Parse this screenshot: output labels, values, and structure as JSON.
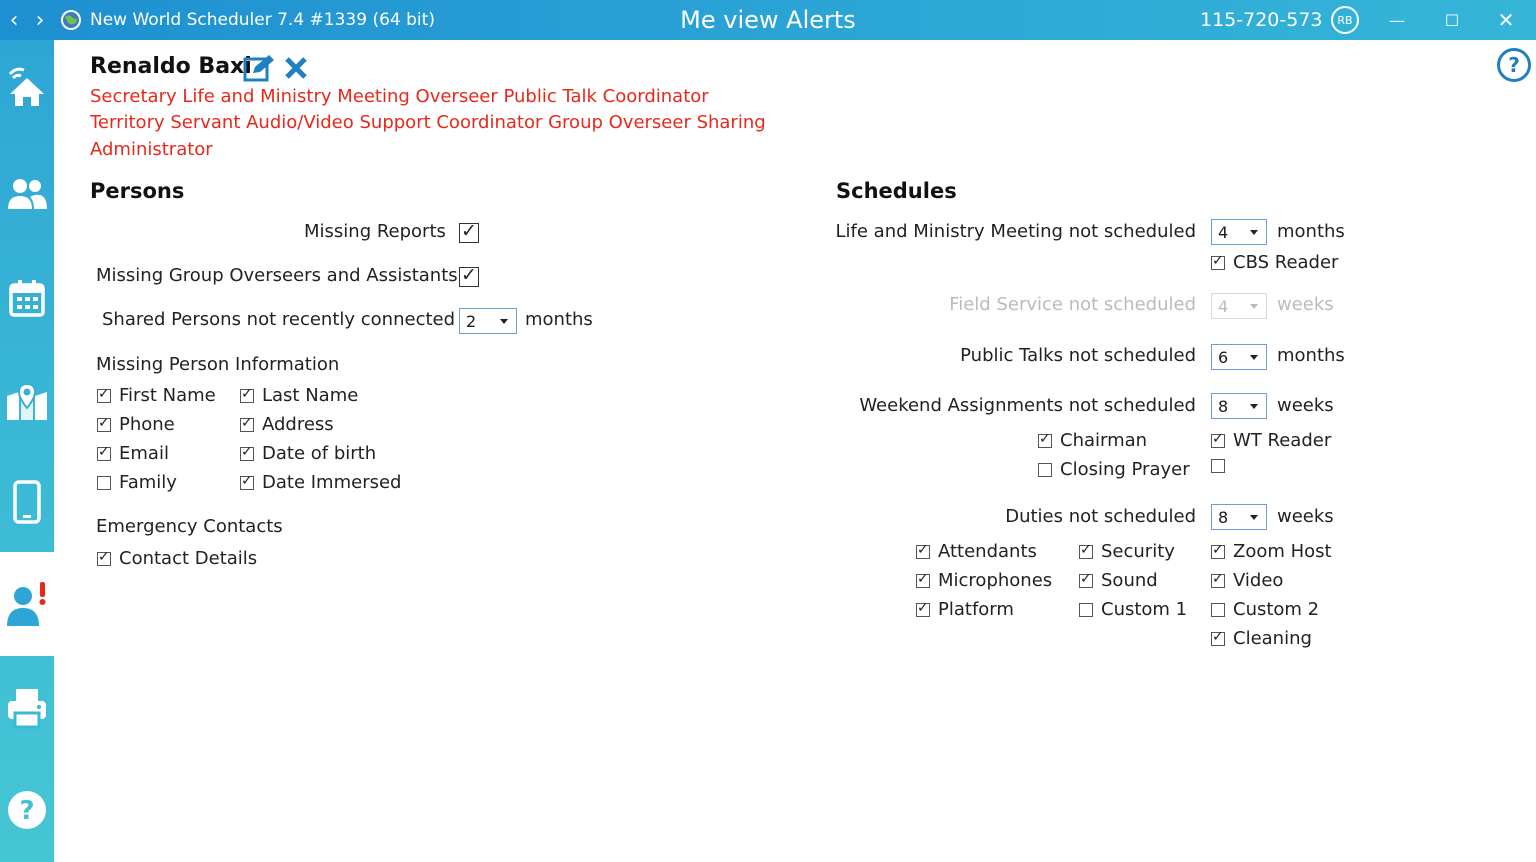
{
  "window": {
    "app_title": "New World Scheduler 7.4 #1339 (64 bit)",
    "view_title": "Me view Alerts",
    "user_id": "115-720-573",
    "avatar_initials": "RB",
    "accent_color": "#2aa3d6"
  },
  "sidebar": {
    "items": [
      {
        "icon": "home-wifi-icon"
      },
      {
        "icon": "people-icon"
      },
      {
        "icon": "calendar-icon"
      },
      {
        "icon": "map-pin-icon"
      },
      {
        "icon": "mobile-icon"
      },
      {
        "icon": "person-alert-icon",
        "active": true
      },
      {
        "icon": "printer-icon"
      },
      {
        "icon": "help-icon"
      }
    ]
  },
  "profile": {
    "name": "Renaldo Baxi",
    "roles_line1": "Secretary Life and Ministry Meeting Overseer Public Talk Coordinator",
    "roles_line2": "Territory Servant Audio/Video Support Coordinator Group Overseer Sharing",
    "roles_line3": "Administrator",
    "role_color": "#e8281b"
  },
  "persons": {
    "title": "Persons",
    "missing_reports": {
      "label": "Missing Reports",
      "checked": true
    },
    "missing_overseers": {
      "label": "Missing Group Overseers and Assistants",
      "checked": true
    },
    "shared_persons": {
      "label": "Shared Persons not recently connected",
      "value": "2",
      "unit": "months"
    },
    "missing_info": {
      "title": "Missing Person Information",
      "first_name": {
        "label": "First Name",
        "checked": true
      },
      "last_name": {
        "label": "Last Name",
        "checked": true
      },
      "phone": {
        "label": "Phone",
        "checked": true
      },
      "address": {
        "label": "Address",
        "checked": true
      },
      "email": {
        "label": "Email",
        "checked": true
      },
      "dob": {
        "label": "Date of birth",
        "checked": true
      },
      "family": {
        "label": "Family",
        "checked": false
      },
      "date_immersed": {
        "label": "Date Immersed",
        "checked": true
      }
    },
    "emergency": {
      "title": "Emergency Contacts",
      "contact_details": {
        "label": "Contact Details",
        "checked": true
      }
    }
  },
  "schedules": {
    "title": "Schedules",
    "lmm": {
      "label": "Life and Ministry Meeting not scheduled",
      "value": "4",
      "unit": "months"
    },
    "cbs_reader": {
      "label": "CBS Reader",
      "checked": true
    },
    "field_service": {
      "label": "Field Service not scheduled",
      "value": "4",
      "unit": "weeks"
    },
    "public_talks": {
      "label": "Public Talks not scheduled",
      "value": "6",
      "unit": "months"
    },
    "weekend": {
      "label": "Weekend Assignments not scheduled",
      "value": "8",
      "unit": "weeks"
    },
    "chairman": {
      "label": "Chairman",
      "checked": true
    },
    "wt_reader": {
      "label": "WT Reader",
      "checked": true
    },
    "closing_prayer": {
      "label": "Closing Prayer",
      "checked": false
    },
    "unlabeled": {
      "checked": false
    },
    "duties": {
      "label": "Duties not scheduled",
      "value": "8",
      "unit": "weeks"
    },
    "attendants": {
      "label": "Attendants",
      "checked": true
    },
    "security": {
      "label": "Security",
      "checked": true
    },
    "zoom_host": {
      "label": "Zoom Host",
      "checked": true
    },
    "microphones": {
      "label": "Microphones",
      "checked": true
    },
    "sound": {
      "label": "Sound",
      "checked": true
    },
    "video": {
      "label": "Video",
      "checked": true
    },
    "platform": {
      "label": "Platform",
      "checked": true
    },
    "custom1": {
      "label": "Custom 1",
      "checked": false
    },
    "custom2": {
      "label": "Custom 2",
      "checked": false
    },
    "cleaning": {
      "label": "Cleaning",
      "checked": true
    }
  }
}
